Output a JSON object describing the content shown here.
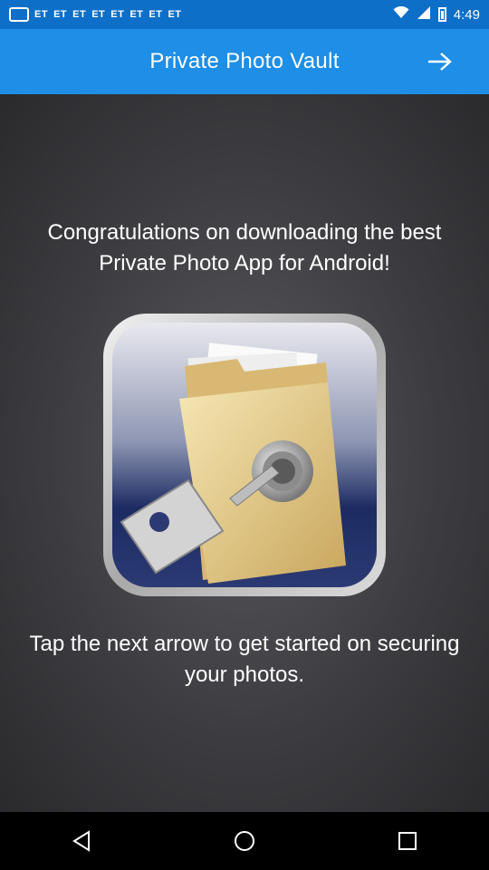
{
  "status_bar": {
    "carrier_labels": [
      "ET",
      "ET",
      "ET",
      "ET",
      "ET",
      "ET",
      "ET",
      "ET"
    ],
    "time": "4:49"
  },
  "app_bar": {
    "title": "Private Photo Vault",
    "next_icon": "arrow-right-icon"
  },
  "content": {
    "congrats_text": "Congratulations on downloading the best Private Photo App for Android!",
    "image_icon": "folder-key-lock-icon",
    "instruction_text": "Tap the next arrow to get started on securing your photos."
  },
  "nav_bar": {
    "back_icon": "back-triangle-icon",
    "home_icon": "home-circle-icon",
    "recents_icon": "recents-square-icon"
  },
  "colors": {
    "status_bar": "#0d6fc7",
    "app_bar": "#1e8ee6",
    "background": "#3d3d41"
  }
}
